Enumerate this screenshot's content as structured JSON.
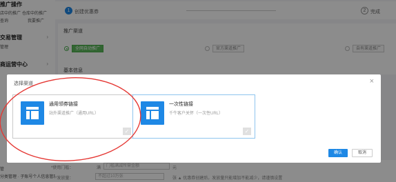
{
  "sidebar": {
    "section1_title": "推广操作",
    "row1": [
      "店中的推广",
      "仓库中的推广"
    ],
    "row2": [
      "查询",
      "我要推广"
    ],
    "section2_title": "交易管理",
    "section2_link": "管理",
    "section3_title": "商运营中心",
    "lower_link1": "管",
    "lower_link2": "分类管理 · 子账号个人信息管理"
  },
  "steps": {
    "step1_num": "1",
    "step1_label": "创建优惠券",
    "step2_num": "2",
    "step2_label": "完成"
  },
  "channel_panel": {
    "title": "推广渠道",
    "options": [
      "全网自动推广",
      "官方渠道推广",
      "自有渠道推广"
    ]
  },
  "basic_panel": {
    "title": "基本信息"
  },
  "bottom": {
    "label1": "*使用门槛：",
    "field1": "满",
    "field1_placeholder": "门槛满减所需金额",
    "unit1": "元",
    "label2": "*发放量：",
    "field2_placeholder": "不超过10万张",
    "hint": "张  ▲ 优惠券创建后，发放量只能增加不能减少，请谨慎设置"
  },
  "modal": {
    "title": "选择渠道",
    "close_symbol": "×",
    "cards": [
      {
        "title": "通用领券链接",
        "desc": "站外渠道推广（通用URL）"
      },
      {
        "title": "一次性链接",
        "desc": "千牛客户关怀（一次性URL）"
      }
    ],
    "check_symbol": "✓",
    "ok_label": "确认",
    "cancel_label": "取消"
  },
  "colors": {
    "accent": "#1e88e5",
    "green": "#5cb85c",
    "annotation": "#e53935"
  }
}
